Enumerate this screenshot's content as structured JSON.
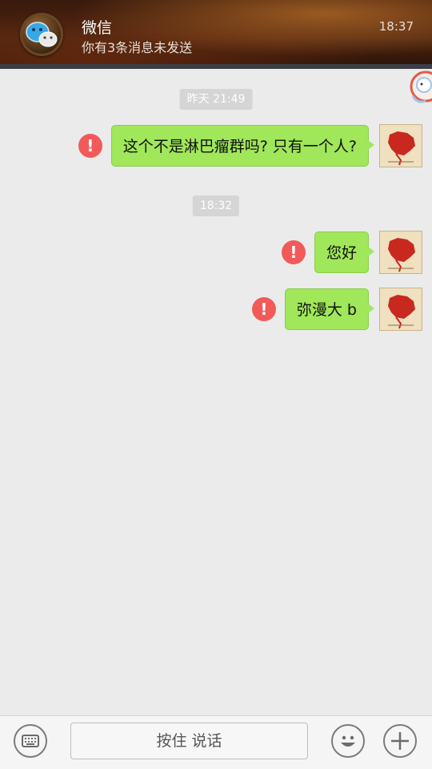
{
  "notification": {
    "app_name": "微信",
    "message": "你有3条消息未发送",
    "time": "18:37",
    "icon": "wechat-icon"
  },
  "chat": {
    "timestamps": [
      "昨天 21:49",
      "18:32"
    ],
    "messages": [
      {
        "text": "这个不是淋巴瘤群吗? 只有一个人?",
        "status": "failed"
      },
      {
        "text": "您好",
        "status": "failed"
      },
      {
        "text": "弥漫大 b",
        "status": "failed"
      }
    ],
    "fail_glyph": "!"
  },
  "input_bar": {
    "hold_to_talk": "按住 说话",
    "keyboard_icon": "keyboard-icon",
    "emoji_icon": "emoji-icon",
    "plus_icon": "plus-icon"
  },
  "colors": {
    "bubble": "#a0e75a",
    "fail": "#f25a5a",
    "background": "#ebebeb"
  }
}
